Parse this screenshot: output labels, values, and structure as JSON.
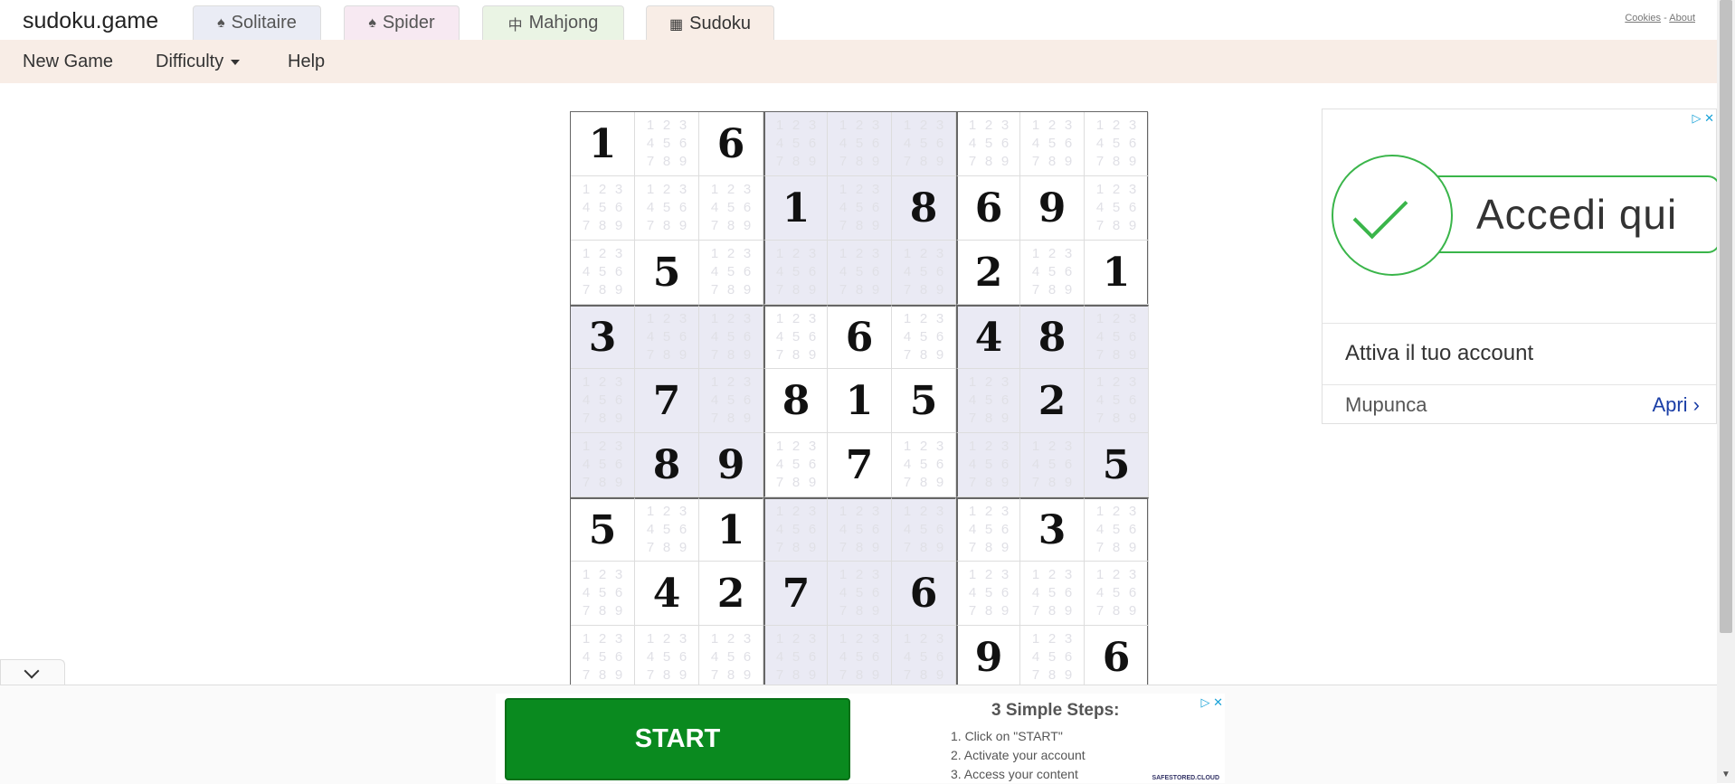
{
  "site": {
    "title": "sudoku.game"
  },
  "tabs": [
    {
      "label": "Solitaire",
      "icon": "spade-icon"
    },
    {
      "label": "Spider",
      "icon": "spade-icon"
    },
    {
      "label": "Mahjong",
      "icon": "mahjong-tile-icon"
    },
    {
      "label": "Sudoku",
      "icon": "grid-icon",
      "active": true
    }
  ],
  "top_links": {
    "cookies": "Cookies",
    "separator": "-",
    "about": "About"
  },
  "menu": {
    "new_game": "New Game",
    "difficulty": "Difficulty",
    "help": "Help"
  },
  "board": {
    "rows": [
      [
        1,
        0,
        6,
        0,
        0,
        0,
        0,
        0,
        0
      ],
      [
        0,
        0,
        0,
        1,
        0,
        8,
        6,
        9,
        0
      ],
      [
        0,
        5,
        0,
        0,
        0,
        0,
        2,
        0,
        1
      ],
      [
        3,
        0,
        0,
        0,
        6,
        0,
        4,
        8,
        0
      ],
      [
        0,
        7,
        0,
        8,
        1,
        5,
        0,
        2,
        0
      ],
      [
        0,
        8,
        9,
        0,
        7,
        0,
        0,
        0,
        5
      ],
      [
        5,
        0,
        1,
        0,
        0,
        0,
        0,
        3,
        0
      ],
      [
        0,
        4,
        2,
        7,
        0,
        6,
        0,
        0,
        0
      ],
      [
        0,
        0,
        0,
        0,
        0,
        0,
        9,
        0,
        6
      ]
    ],
    "note_digits": [
      "1",
      "2",
      "3",
      "4",
      "5",
      "6",
      "7",
      "8",
      "9"
    ]
  },
  "side_ad": {
    "badge": "▷ ✕",
    "cta_text": "Accedi qui",
    "headline": "Attiva il tuo account",
    "advertiser": "Mupunca",
    "open_label": "Apri ›",
    "accent_color": "#3ab54a"
  },
  "bottom_ad": {
    "button": "START",
    "steps_title": "3 Simple Steps:",
    "steps": [
      "1. Click on \"START\"",
      "2. Activate your account",
      "3. Access your content"
    ],
    "badge": "▷ ✕",
    "brand": "SAFESTORED.CLOUD",
    "button_color": "#0a8a1f"
  }
}
